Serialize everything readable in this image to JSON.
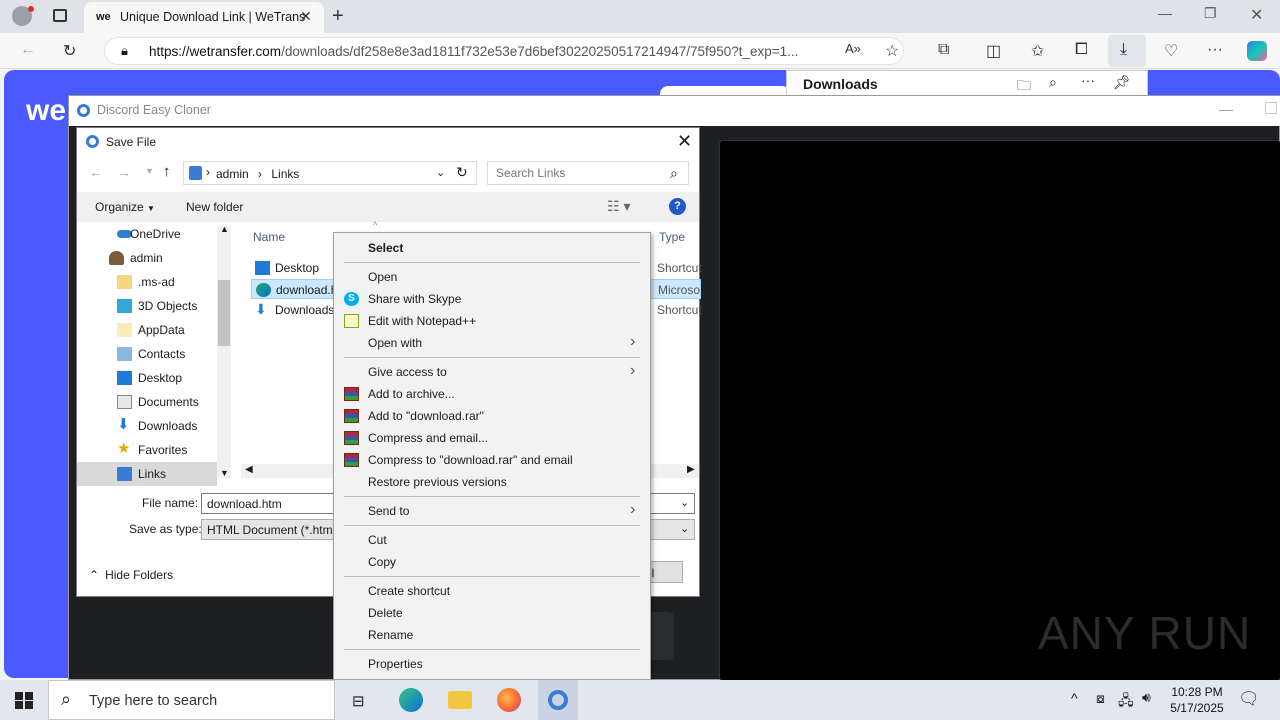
{
  "browser": {
    "tab_title": "Unique Download Link | WeTrans",
    "tab_logo": "we",
    "url_host": "https://wetransfer.com",
    "url_path": "/downloads/df258e8e3ad1811f732e53e7d6bef30220250517214947/75f950?t_exp=1...",
    "downloads_title": "Downloads",
    "page_logo": "we"
  },
  "app_window": {
    "title": "Discord Easy Cloner"
  },
  "save_dialog": {
    "title": "Save File",
    "breadcrumb": [
      "admin",
      "Links"
    ],
    "search_placeholder": "Search Links",
    "organize_label": "Organize",
    "new_folder_label": "New folder",
    "help_label": "?",
    "tree": [
      {
        "label": "OneDrive",
        "icon": "onedrive-icon"
      },
      {
        "label": "admin",
        "icon": "user-icon"
      },
      {
        "label": ".ms-ad",
        "icon": "folder-icon"
      },
      {
        "label": "3D Objects",
        "icon": "3d-objects-icon"
      },
      {
        "label": "AppData",
        "icon": "folder-icon"
      },
      {
        "label": "Contacts",
        "icon": "contacts-icon"
      },
      {
        "label": "Desktop",
        "icon": "desktop-icon"
      },
      {
        "label": "Documents",
        "icon": "documents-icon"
      },
      {
        "label": "Downloads",
        "icon": "downloads-icon"
      },
      {
        "label": "Favorites",
        "icon": "star-icon"
      },
      {
        "label": "Links",
        "icon": "links-icon"
      }
    ],
    "columns": {
      "name": "Name",
      "type": "Type"
    },
    "files": [
      {
        "name": "Desktop",
        "type": "Shortcut"
      },
      {
        "name": "download.h",
        "type": "Microso"
      },
      {
        "name": "Downloads",
        "type": "Shortcut"
      }
    ],
    "file_name_label": "File name:",
    "file_name_value": "download.htm",
    "save_type_label": "Save as type:",
    "save_type_value": "HTML Document (*.htm",
    "hide_folders_label": "Hide Folders",
    "cancel_label": "el"
  },
  "context_menu": {
    "header": "Select",
    "groups": [
      [
        {
          "label": "Open"
        },
        {
          "label": "Share with Skype",
          "icon": "skype-icon"
        },
        {
          "label": "Edit with Notepad++",
          "icon": "notepadpp-icon"
        },
        {
          "label": "Open with",
          "submenu": true
        }
      ],
      [
        {
          "label": "Give access to",
          "submenu": true
        },
        {
          "label": "Add to archive...",
          "icon": "winrar-icon"
        },
        {
          "label": "Add to \"download.rar\"",
          "icon": "winrar-icon"
        },
        {
          "label": "Compress and email...",
          "icon": "winrar-icon"
        },
        {
          "label": "Compress to \"download.rar\" and email",
          "icon": "winrar-icon"
        },
        {
          "label": "Restore previous versions"
        }
      ],
      [
        {
          "label": "Send to",
          "submenu": true
        }
      ],
      [
        {
          "label": "Cut"
        },
        {
          "label": "Copy"
        }
      ],
      [
        {
          "label": "Create shortcut"
        },
        {
          "label": "Delete"
        },
        {
          "label": "Rename"
        }
      ],
      [
        {
          "label": "Properties"
        }
      ]
    ]
  },
  "taskbar": {
    "search_placeholder": "Type here to search",
    "time": "10:28 PM",
    "date": "5/17/2025"
  },
  "watermark": "ANY RUN"
}
